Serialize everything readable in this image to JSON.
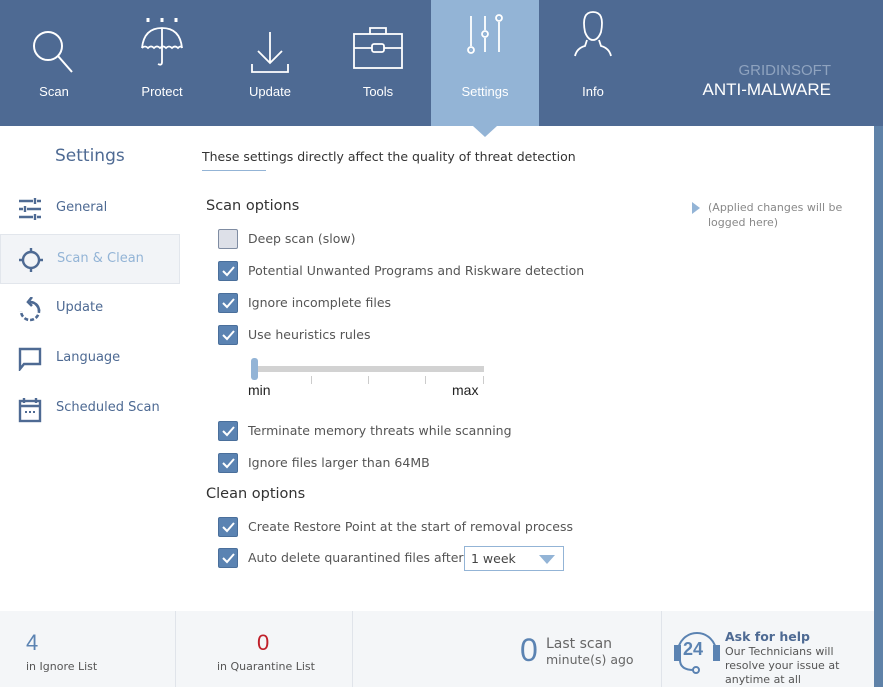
{
  "header": {
    "tabs": [
      {
        "label": "Scan",
        "icon": "magnifier-icon"
      },
      {
        "label": "Protect",
        "icon": "umbrella-icon"
      },
      {
        "label": "Update",
        "icon": "download-icon"
      },
      {
        "label": "Tools",
        "icon": "toolbox-icon"
      },
      {
        "label": "Settings",
        "icon": "sliders-icon",
        "active": true
      },
      {
        "label": "Info",
        "icon": "person-icon"
      }
    ],
    "brand_top": "GRIDINSOFT",
    "brand_bottom": "ANTI-MALWARE"
  },
  "sidebar": {
    "title": "Settings",
    "items": [
      {
        "label": "General",
        "icon": "sliders-horizontal-icon"
      },
      {
        "label": "Scan & Clean",
        "icon": "crosshair-icon",
        "active": true
      },
      {
        "label": "Update",
        "icon": "refresh-icon"
      },
      {
        "label": "Language",
        "icon": "speech-bubble-icon"
      },
      {
        "label": "Scheduled Scan",
        "icon": "calendar-icon"
      }
    ]
  },
  "main": {
    "intro": "These settings directly affect the quality of threat detection",
    "scan_options_title": "Scan options",
    "scan_options": [
      {
        "label": "Deep scan (slow)",
        "checked": false
      },
      {
        "label": "Potential Unwanted Programs and Riskware detection",
        "checked": true
      },
      {
        "label": "Ignore incomplete files",
        "checked": true
      },
      {
        "label": "Use heuristics rules",
        "checked": true
      }
    ],
    "heuristics_slider": {
      "min_label": "min",
      "max_label": "max",
      "level": 0,
      "levels": 4
    },
    "scan_options_2": [
      {
        "label": "Terminate memory threats while scanning",
        "checked": true
      },
      {
        "label": "Ignore files larger than 64MB",
        "checked": true
      }
    ],
    "clean_options_title": "Clean options",
    "clean_options": [
      {
        "label": "Create Restore Point at the start of removal process",
        "checked": true
      },
      {
        "label": "Auto delete quarantined files after",
        "checked": true
      }
    ],
    "auto_delete_period": "1 week",
    "log_text": "(Applied changes will be logged here)"
  },
  "footer": {
    "ignore_count": "4",
    "ignore_label": "in Ignore List",
    "quarantine_count": "0",
    "quarantine_label": "in Quarantine List",
    "last_scan_value": "0",
    "last_scan_title": "Last scan",
    "last_scan_unit": "minute(s) ago",
    "help_badge": "24",
    "help_title": "Ask for help",
    "help_text": "Our Technicians will resolve your issue at anytime at all"
  },
  "colors": {
    "header": "#4e6a93",
    "accent": "#93b4d6",
    "checkbox": "#5b83b2",
    "quarantine_count": "#c0202a"
  }
}
